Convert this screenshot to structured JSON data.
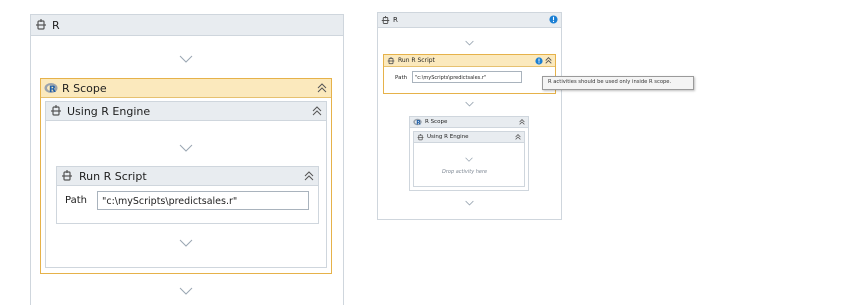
{
  "left": {
    "outer_title": "R",
    "scope_title": "R Scope",
    "engine_title": "Using R Engine",
    "script_title": "Run R Script",
    "path_label": "Path",
    "path_value": "\"c:\\myScripts\\predictsales.r\""
  },
  "right": {
    "outer_title": "R",
    "script_title": "Run R Script",
    "path_label": "Path",
    "path_value": "\"c:\\myScripts\\predictsales.r\"",
    "tooltip": "R activities should be used only inside R scope.",
    "scope_title": "R Scope",
    "engine_title": "Using R Engine",
    "drop_hint": "Drop activity here"
  },
  "colors": {
    "header_gray": "#e8ecf0",
    "selected_header": "#fbe9bd",
    "selected_border": "#e6b24a",
    "warning_blue": "#1a7fd4"
  },
  "icons": [
    "activity-gear-icon",
    "r-logo-icon",
    "collapse-chevron-icon",
    "info-icon",
    "drop-arrow-icon"
  ]
}
